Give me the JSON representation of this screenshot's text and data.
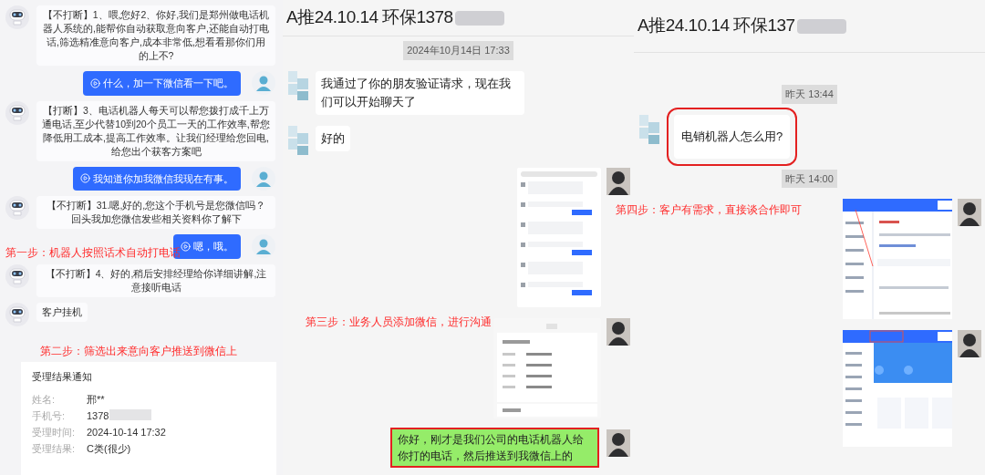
{
  "robot_call_log": {
    "messages": [
      {
        "kind": "bot",
        "text": "【不打断】1、喂,您好2、你好,我们是郑州做电话机器人系统的,能帮你自动获取意向客户,还能自动打电话,筛选精准意向客户,成本非常低,想看看那你们用的上不?"
      },
      {
        "kind": "user",
        "text": "什么，加一下微信看一下吧。"
      },
      {
        "kind": "bot",
        "text": "【打断】3、电话机器人每天可以帮您拨打成千上万通电话,至少代替10到20个员工一天的工作效率,帮您降低用工成本,提高工作效率。让我们经理给您回电,给您出个获客方案吧"
      },
      {
        "kind": "user",
        "text": "我知道你加我微信我现在有事。"
      },
      {
        "kind": "bot",
        "text": "【不打断】31.嗯,好的,您这个手机号是您微信吗？回头我加您微信发些相关资料你了解下"
      },
      {
        "kind": "user",
        "text": "嗯，哦。"
      },
      {
        "kind": "bot",
        "text": "【不打断】4、好的,稍后安排经理给你详细讲解,注意接听电话"
      },
      {
        "kind": "bot",
        "text": "客户挂机"
      }
    ],
    "result_card": {
      "title": "受理结果通知",
      "fields": [
        {
          "label": "姓名:",
          "value": "邢**",
          "blurred": false
        },
        {
          "label": "手机号:",
          "value": "1378",
          "blurred": true
        },
        {
          "label": "受理时间:",
          "value": "2024-10-14 17:32",
          "blurred": false
        },
        {
          "label": "受理结果:",
          "value": "C类(很少)",
          "blurred": false
        }
      ]
    }
  },
  "wechat_chat_1": {
    "title": "A推24.10.14 环保1378",
    "items": [
      {
        "kind": "time",
        "text": "2024年10月14日 17:33"
      },
      {
        "kind": "incoming",
        "text": "我通过了你的朋友验证请求，现在我们可以开始聊天了",
        "highlighted": false
      },
      {
        "kind": "incoming",
        "text": "好的",
        "highlighted": false
      },
      {
        "kind": "chat_image"
      },
      {
        "kind": "card_image"
      },
      {
        "kind": "outgoing_text",
        "text": "你好，刚才是我们公司的电话机器人给你打的电话，然后推送到我微信上的",
        "highlighted": true
      }
    ]
  },
  "wechat_chat_2": {
    "title": "A推24.10.14 环保137",
    "items": [
      {
        "kind": "time",
        "text": "昨天 13:44"
      },
      {
        "kind": "incoming",
        "text": "电销机器人怎么用?",
        "highlighted": true
      },
      {
        "kind": "time",
        "text": "昨天 14:00"
      },
      {
        "kind": "dashboard_image"
      },
      {
        "kind": "home_image"
      }
    ]
  },
  "steps": [
    {
      "text": "第一步：机器人按照话术自动打电话"
    },
    {
      "text": "第二步：筛选出来意向客户推送到微信上"
    },
    {
      "text": "第三步：业务人员添加微信，进行沟通"
    },
    {
      "text": "第四步：客户有需求，直接谈合作即可"
    }
  ]
}
